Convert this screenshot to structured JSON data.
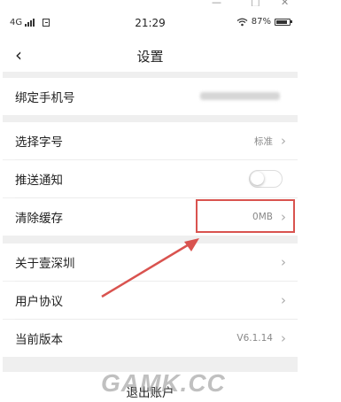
{
  "window": {
    "minimize": "—",
    "maximize": "□",
    "close": "✕"
  },
  "status_bar": {
    "network": "4G",
    "time": "21:29",
    "battery_text": "87%",
    "wifi_icon": "wifi-icon"
  },
  "header": {
    "back_icon": "‹",
    "title": "设置"
  },
  "settings": {
    "bind_phone": {
      "label": "绑定手机号"
    },
    "font_size": {
      "label": "选择字号",
      "value": "标准"
    },
    "push": {
      "label": "推送通知",
      "enabled": false
    },
    "clear_cache": {
      "label": "清除缓存",
      "value": "0MB"
    },
    "about": {
      "label": "关于壹深圳"
    },
    "agreement": {
      "label": "用户协议"
    },
    "version": {
      "label": "当前版本",
      "value": "V6.1.14"
    }
  },
  "chevron": "›",
  "logout": {
    "label": "退出账户"
  },
  "watermark": "GAMK.CC",
  "colors": {
    "annotation": "#d9534f",
    "background": "#efefef"
  }
}
